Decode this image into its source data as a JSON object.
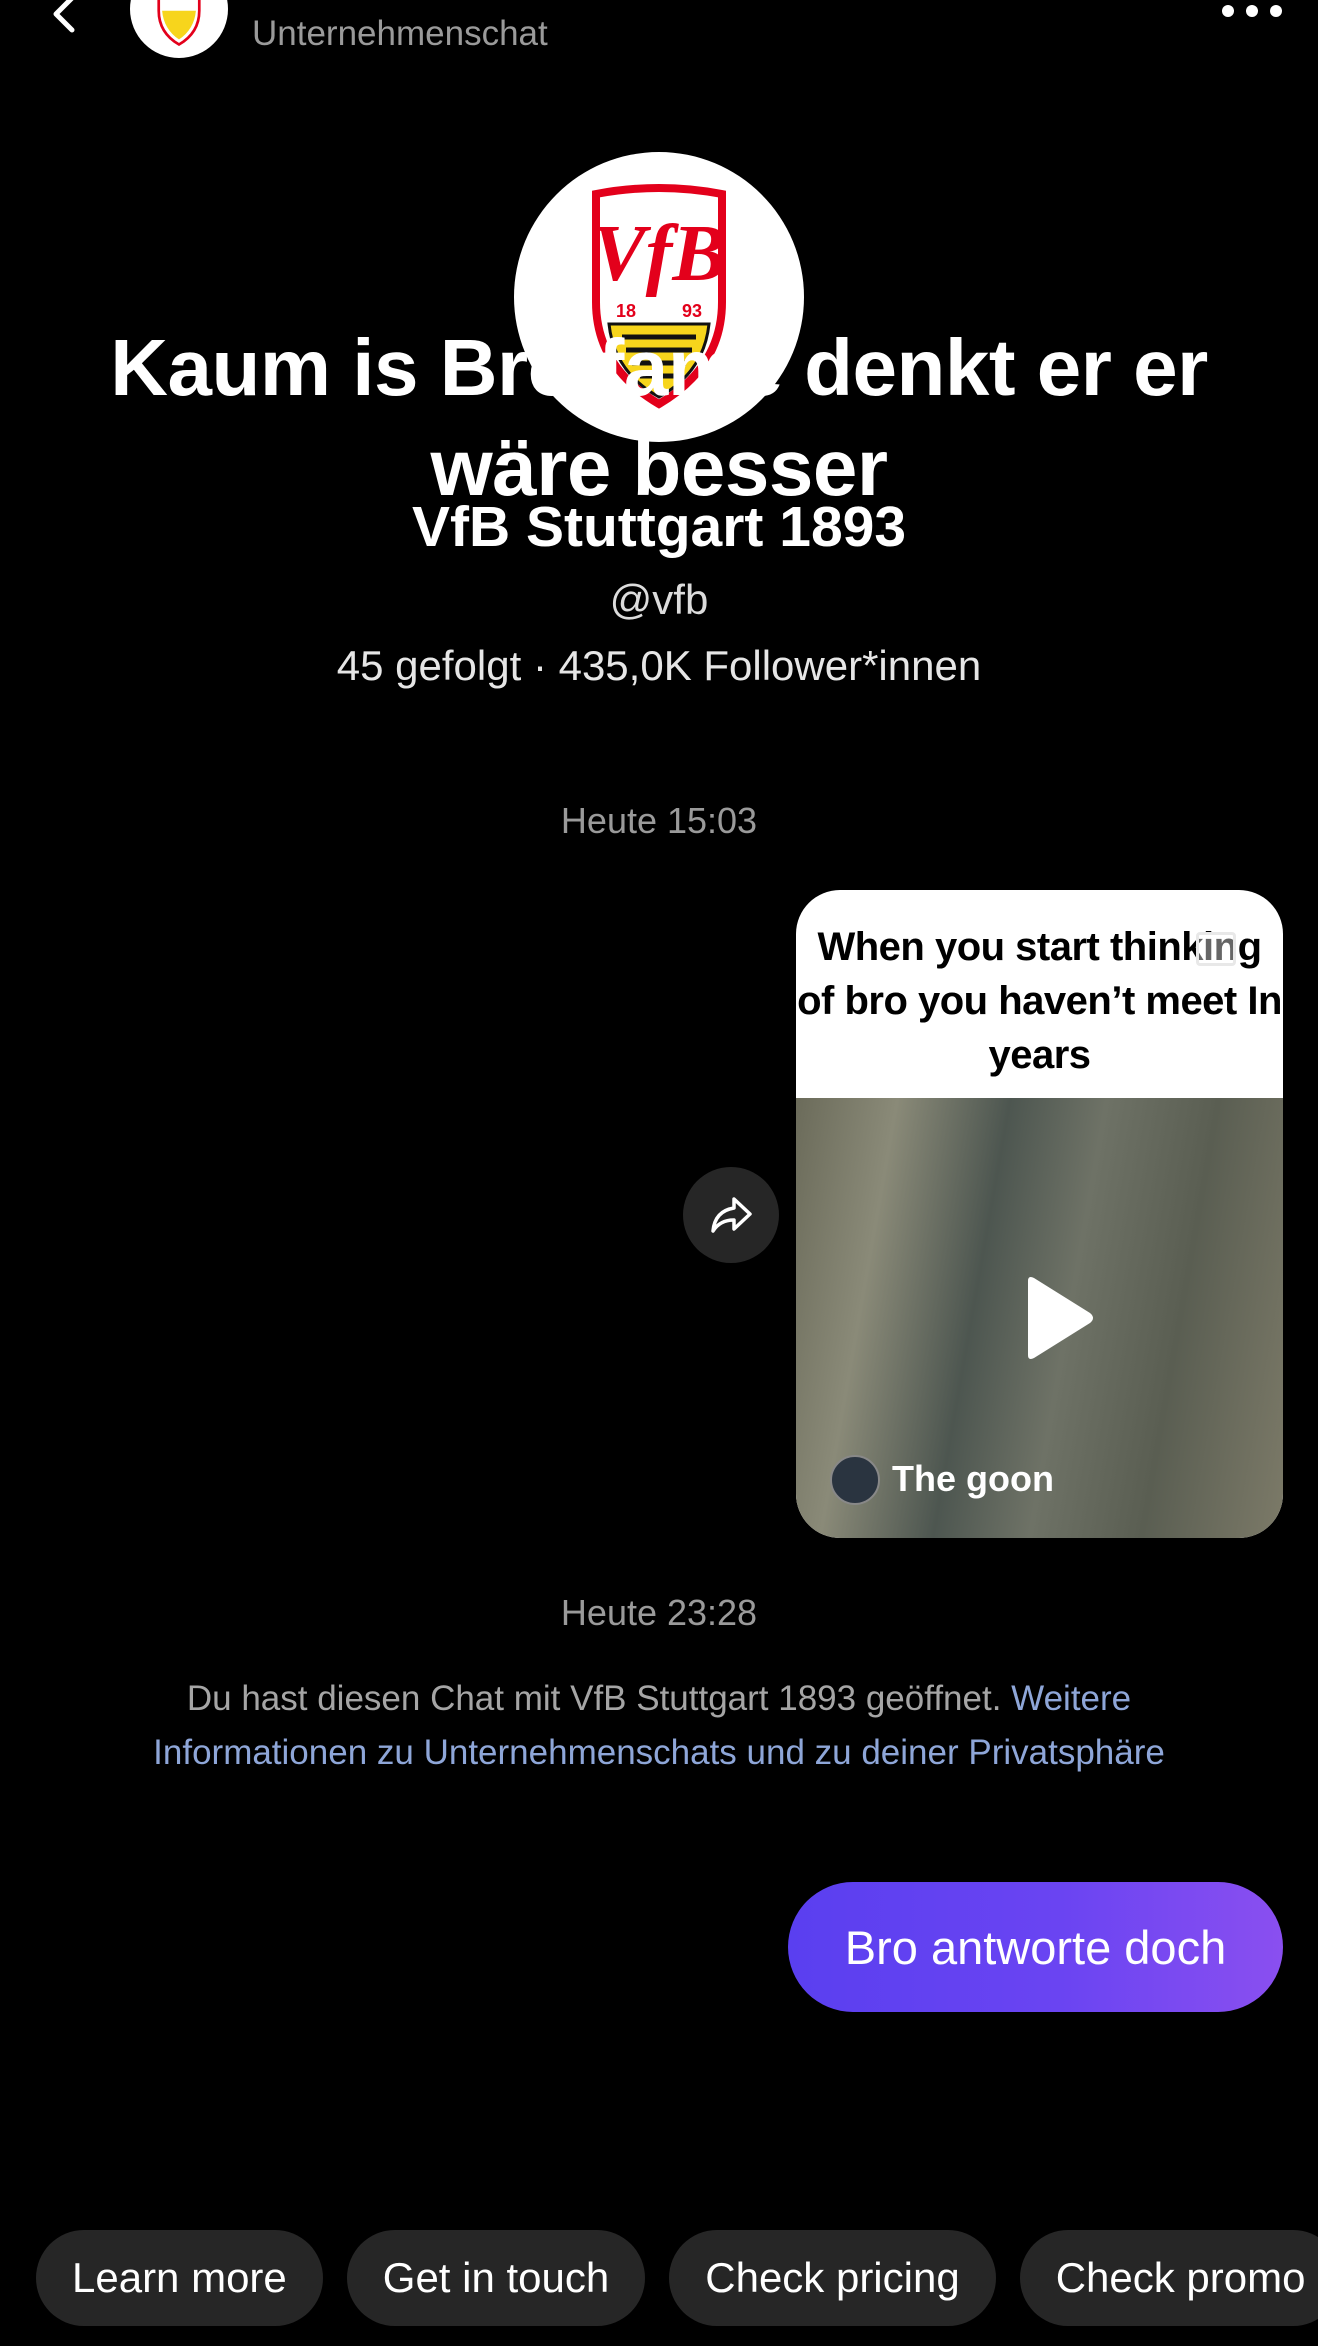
{
  "header": {
    "subtitle": "Unternehmenschat",
    "back_icon": "chevron-left-icon",
    "more_icon": "more-horizontal-icon"
  },
  "profile": {
    "overlay_caption": "Kaum is Bro fame denkt er er wäre besser",
    "name": "VfB Stuttgart 1893",
    "handle": "@vfb",
    "stats": "45 gefolgt · 435,0K Follower*innen",
    "logo": {
      "top_text": "VfB",
      "year_left": "18",
      "year_right": "93",
      "colors": {
        "red": "#e3001b",
        "yellow": "#f7d51c",
        "black": "#111111"
      }
    }
  },
  "messages": {
    "timestamp_1": "Heute 15:03",
    "video": {
      "caption": "When you start thinking of bro you haven’t meet In years",
      "author": "The goon"
    },
    "timestamp_2": "Heute 23:28",
    "info_text": "Du hast diesen Chat mit VfB Stuttgart 1893 geöffnet.",
    "info_link": "Weitere Informationen zu Unternehmenschats und zu deiner Privatsphäre",
    "sent_text": "Bro antworte doch"
  },
  "quick_replies": [
    "Learn more",
    "Get in touch",
    "Check pricing",
    "Check promo"
  ],
  "colors": {
    "background": "#000000",
    "bubble_start": "#5a3ff0",
    "bubble_end": "#8a4ff0",
    "link": "#8ea6d8",
    "chip": "#262626"
  }
}
